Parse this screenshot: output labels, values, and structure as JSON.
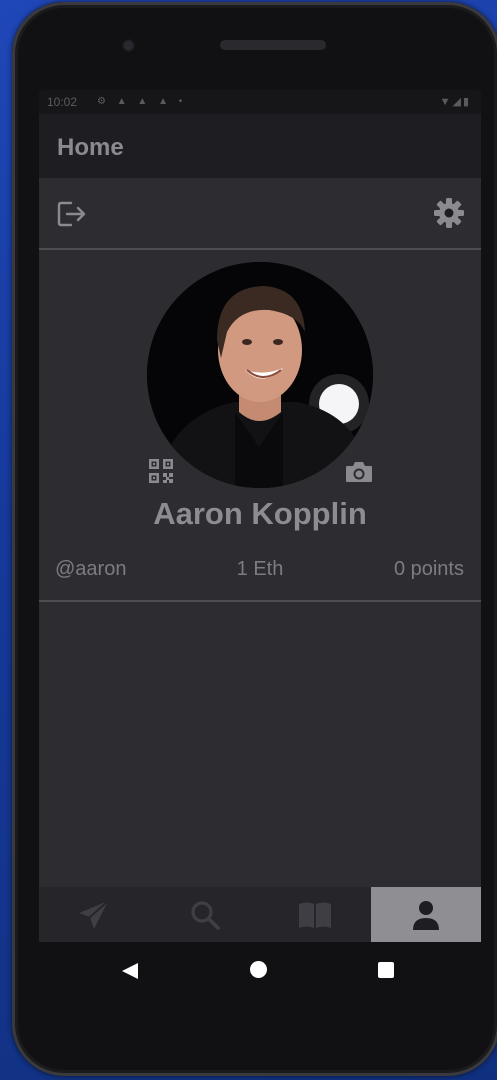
{
  "status_bar": {
    "time": "10:02",
    "left_icons": "⚙ ▲ ▲ ▲ •",
    "right_icons": "▼◢▮"
  },
  "app_bar": {
    "title": "Home"
  },
  "toolbar": {
    "logout_icon": "logout-icon",
    "settings_icon": "gear-icon"
  },
  "profile": {
    "avatar_icon": "avatar",
    "name": "Aaron Kopplin",
    "handle": "@aaron",
    "balance": "1 Eth",
    "points": "0 points"
  },
  "bottom_nav": {
    "items": [
      {
        "icon": "send-icon",
        "active": false
      },
      {
        "icon": "search-icon",
        "active": false
      },
      {
        "icon": "book-icon",
        "active": false
      },
      {
        "icon": "person-icon",
        "active": true
      }
    ]
  },
  "colors": {
    "background": "#2d2c30",
    "app_bar": "#1e1e22",
    "active_tab": "#8f8e93",
    "text": "#8c8c92"
  }
}
